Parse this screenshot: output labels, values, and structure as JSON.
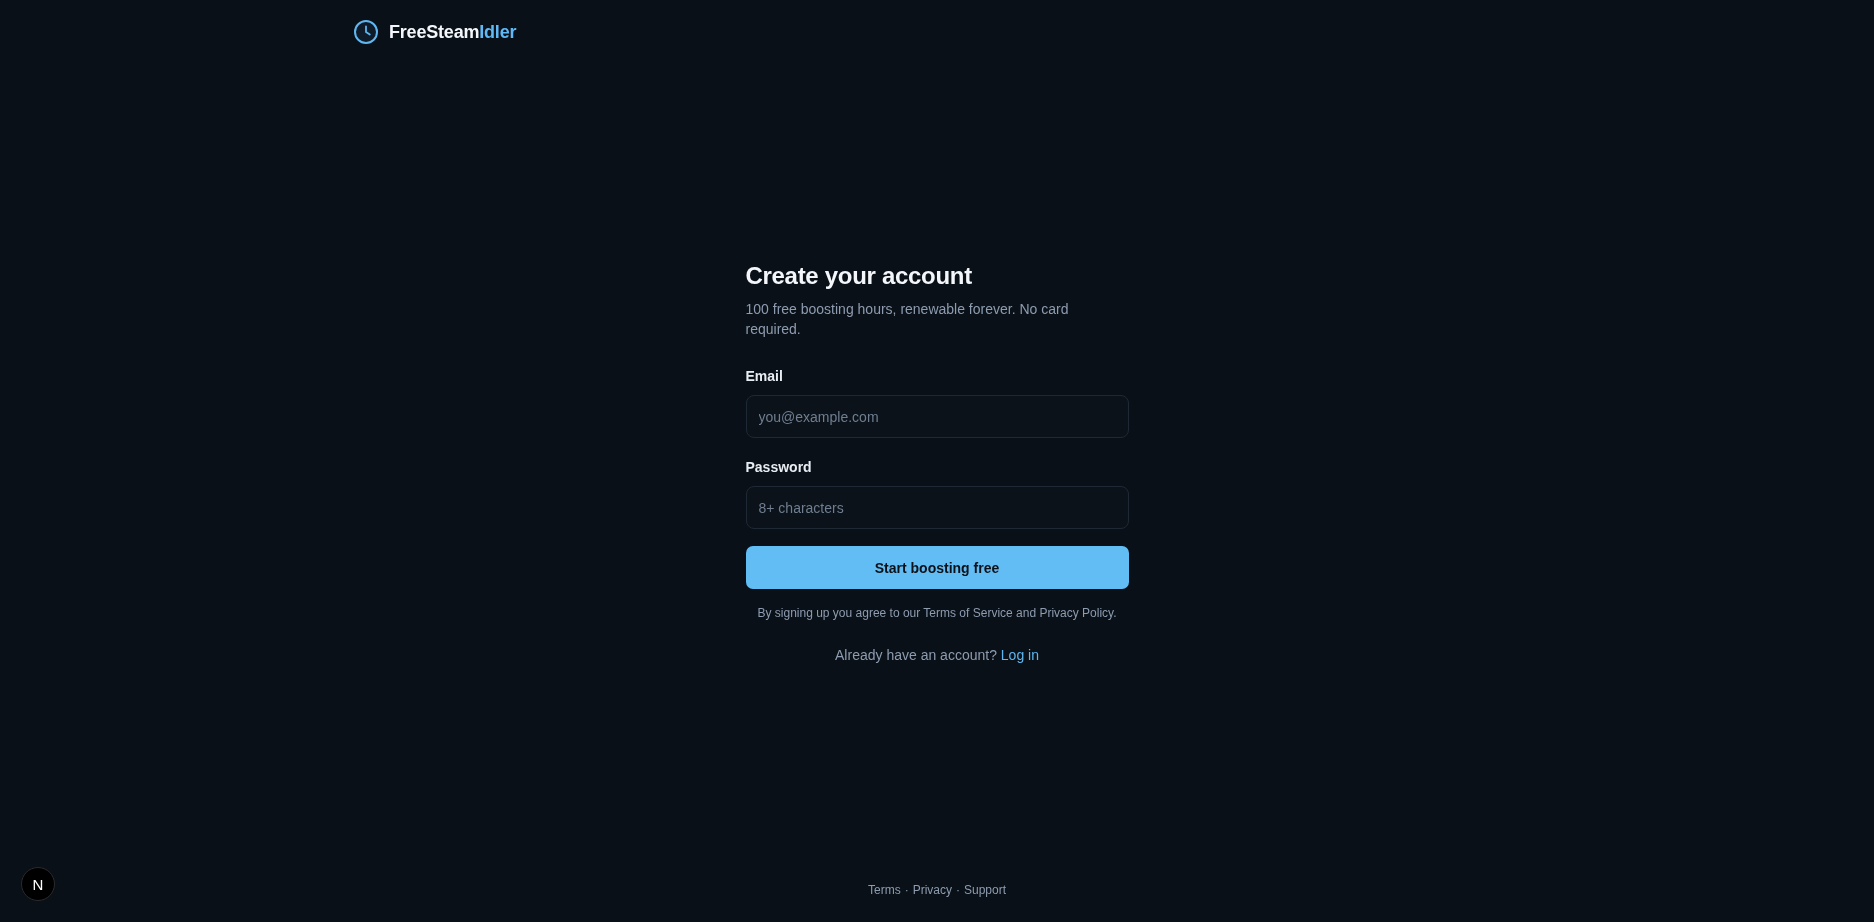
{
  "header": {
    "brand": [
      {
        "text": "FreeSteam",
        "accent": false
      },
      {
        "text": "Idler",
        "accent": true
      }
    ]
  },
  "form": {
    "title": "Create your account",
    "subtitle": "100 free boosting hours, renewable forever. No card required.",
    "fields": [
      {
        "label": "Email",
        "placeholder": "you@example.com"
      },
      {
        "label": "Password",
        "placeholder": "8+ characters"
      }
    ],
    "submit": "Start boosting free",
    "legal": "By signing up you agree to our Terms of Service and Privacy Policy.",
    "login_prompt": {
      "text": "Already have an account?",
      "link": "Log in"
    }
  },
  "footer": {
    "links": [
      "Terms",
      "Privacy",
      "Support"
    ],
    "separators": [
      "·",
      "·"
    ]
  },
  "dev_indicator": {
    "label": "N"
  }
}
